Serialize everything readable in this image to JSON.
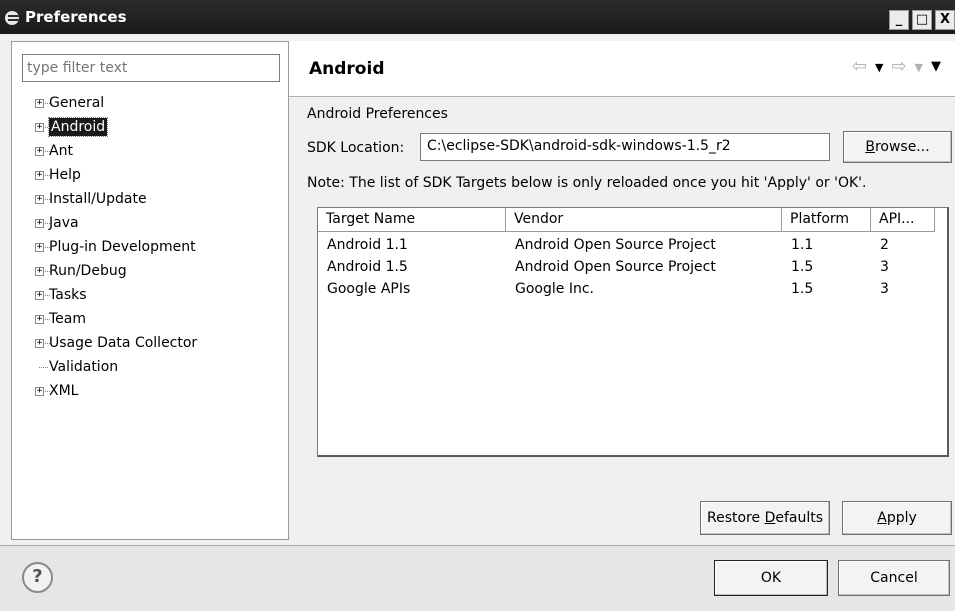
{
  "window": {
    "title": "Preferences",
    "controls": [
      "_",
      "□",
      "X"
    ]
  },
  "filter": {
    "placeholder": "type filter text"
  },
  "tree": [
    {
      "label": "General",
      "expandable": true
    },
    {
      "label": "Android",
      "expandable": true,
      "selected": true
    },
    {
      "label": "Ant",
      "expandable": true
    },
    {
      "label": "Help",
      "expandable": true
    },
    {
      "label": "Install/Update",
      "expandable": true
    },
    {
      "label": "Java",
      "expandable": true
    },
    {
      "label": "Plug-in Development",
      "expandable": true
    },
    {
      "label": "Run/Debug",
      "expandable": true
    },
    {
      "label": "Tasks",
      "expandable": true
    },
    {
      "label": "Team",
      "expandable": true
    },
    {
      "label": "Usage Data Collector",
      "expandable": true
    },
    {
      "label": "Validation",
      "expandable": false
    },
    {
      "label": "XML",
      "expandable": true
    }
  ],
  "page": {
    "title": "Android",
    "section_label": "Android Preferences",
    "sdk_label": "SDK Location:",
    "sdk_value": "C:\\eclipse-SDK\\android-sdk-windows-1.5_r2",
    "browse_pre": "",
    "browse_mnemonic": "B",
    "browse_post": "rowse...",
    "note": "Note: The list of SDK Targets below is only reloaded once you hit 'Apply' or 'OK'.",
    "table": {
      "columns": [
        "Target Name",
        "Vendor",
        "Platform",
        "API..."
      ],
      "rows": [
        [
          "Android 1.1",
          "Android Open Source Project",
          "1.1",
          "2"
        ],
        [
          "Android 1.5",
          "Android Open Source Project",
          "1.5",
          "3"
        ],
        [
          "Google APIs",
          "Google Inc.",
          "1.5",
          "3"
        ]
      ]
    },
    "restore_pre": "Restore ",
    "restore_mnemonic": "D",
    "restore_post": "efaults",
    "apply_pre": "",
    "apply_mnemonic": "A",
    "apply_post": "pply"
  },
  "footer": {
    "help": "?",
    "ok": "OK",
    "cancel": "Cancel"
  },
  "icons": {
    "back": "back-arrow-icon",
    "forward": "forward-arrow-icon",
    "menu": "view-menu-icon"
  }
}
